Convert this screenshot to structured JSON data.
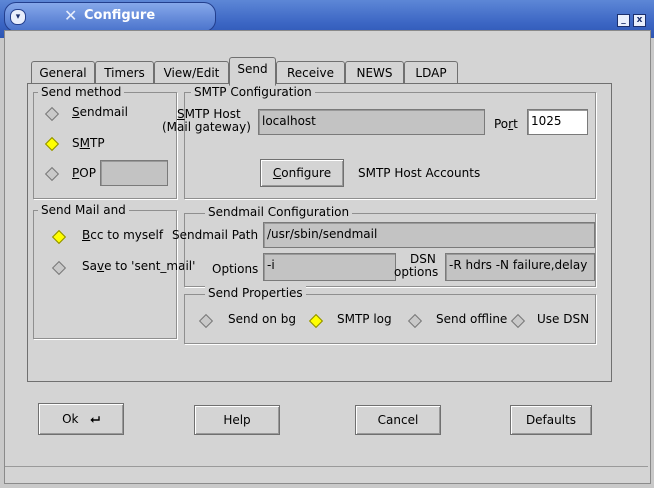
{
  "window": {
    "title": "Configure",
    "sys_icon": "▾",
    "min_icon": "_",
    "close_icon": "x"
  },
  "tabs": [
    "General",
    "Timers",
    "View/Edit",
    "Send",
    "Receive",
    "NEWS",
    "LDAP"
  ],
  "send_method": {
    "title": "Send method",
    "sendmail": "Sendmail",
    "smtp": "SMTP",
    "pop": "POP",
    "pop_value": ""
  },
  "send_mail_and": {
    "title": "Send Mail and",
    "bcc": "Bcc to myself",
    "save": "Save to 'sent_mail'"
  },
  "smtp_config": {
    "title": "SMTP Configuration",
    "host_label_1": "SMTP Host",
    "host_label_2": "(Mail gateway)",
    "host_value": "localhost",
    "port_label": "Port",
    "port_value": "1025",
    "configure_button": "Configure",
    "accounts_label": "SMTP Host Accounts"
  },
  "sendmail_config": {
    "title": "Sendmail Configuration",
    "path_label": "Sendmail Path",
    "path_value": "/usr/sbin/sendmail",
    "options_label": "Options",
    "options_value": "-i",
    "dsn_label_1": "DSN",
    "dsn_label_2": "options",
    "dsn_value": "-R hdrs -N failure,delay"
  },
  "send_properties": {
    "title": "Send Properties",
    "send_on_bg": "Send on bg",
    "smtp_log": "SMTP log",
    "send_offline": "Send offline",
    "use_dsn": "Use DSN"
  },
  "buttons": {
    "ok": "Ok",
    "ok_icon": "⮠",
    "help": "Help",
    "cancel": "Cancel",
    "defaults": "Defaults"
  }
}
